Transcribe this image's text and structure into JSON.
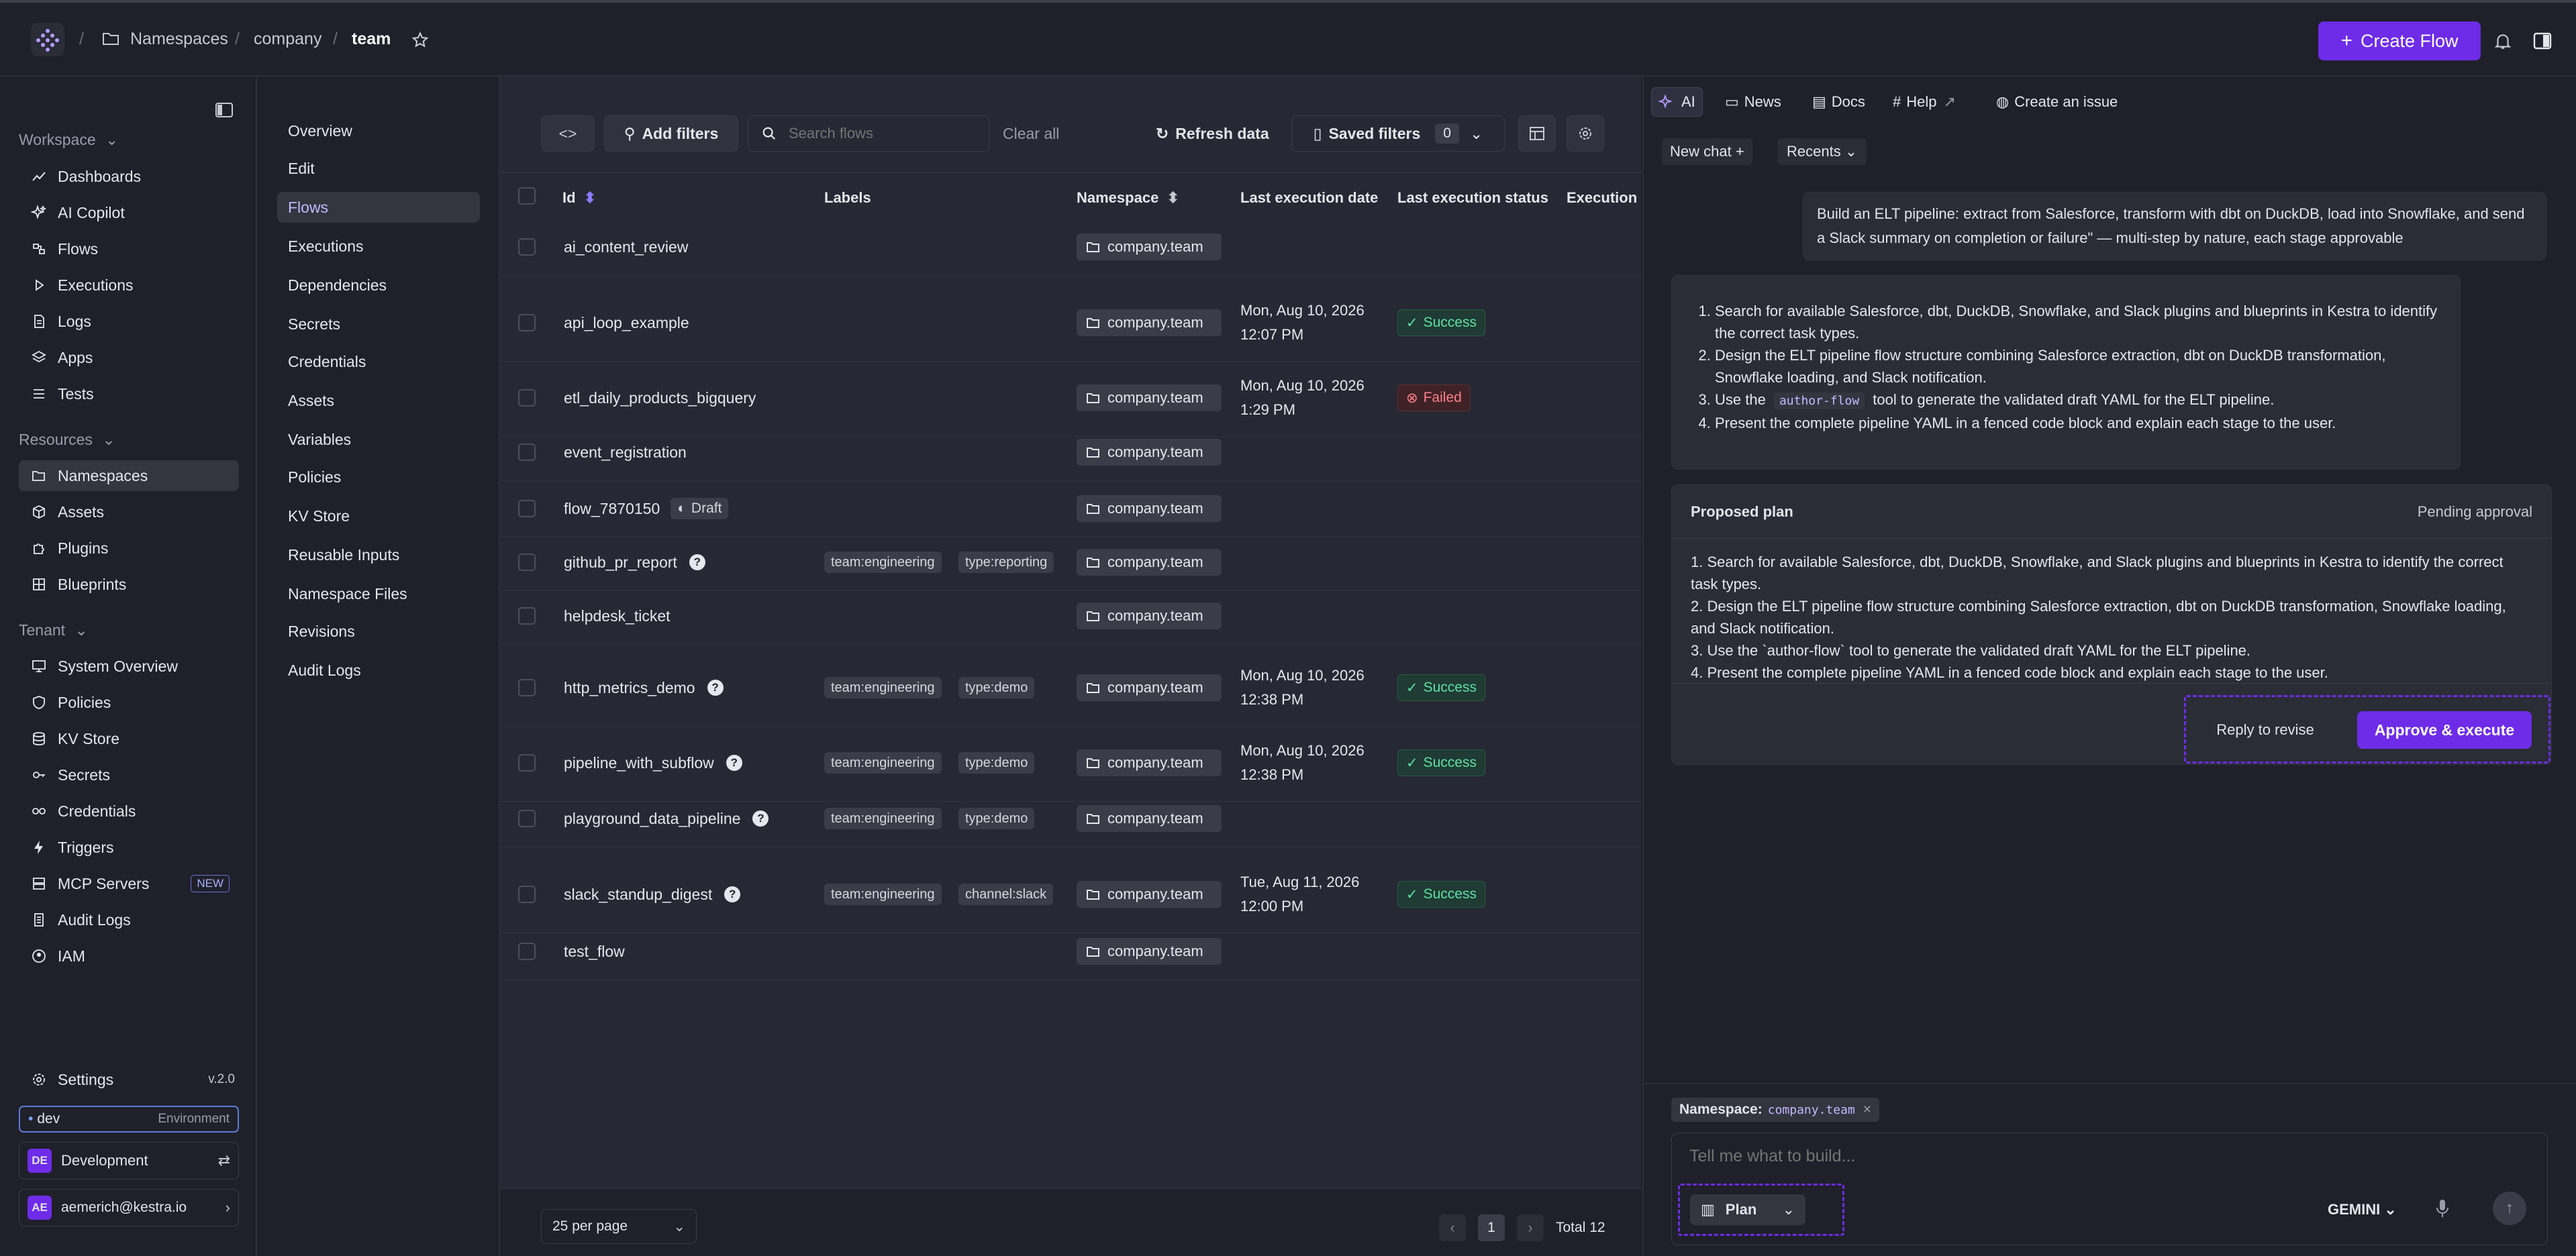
{
  "topbar": {
    "breadcrumb": [
      "Namespaces",
      "company",
      "team"
    ],
    "create_flow": "Create Flow"
  },
  "sidebar": {
    "sections": [
      {
        "title": "Workspace",
        "items": [
          "Dashboards",
          "AI Copilot",
          "Flows",
          "Executions",
          "Logs",
          "Apps",
          "Tests"
        ]
      },
      {
        "title": "Resources",
        "items": [
          "Namespaces",
          "Assets",
          "Plugins",
          "Blueprints"
        ]
      },
      {
        "title": "Tenant",
        "items": [
          "System Overview",
          "Policies",
          "KV Store",
          "Secrets",
          "Credentials",
          "Triggers",
          "MCP Servers",
          "Audit Logs",
          "IAM"
        ]
      }
    ],
    "new_badge": "NEW",
    "settings": "Settings",
    "version": "v.2.0",
    "env": {
      "name": "dev",
      "label": "Environment"
    },
    "tenant": {
      "initials": "DE",
      "name": "Development"
    },
    "user": {
      "initials": "AE",
      "email": "aemerich@kestra.io"
    }
  },
  "subnav": [
    "Overview",
    "Edit",
    "Flows",
    "Executions",
    "Dependencies",
    "Secrets",
    "Credentials",
    "Assets",
    "Variables",
    "Policies",
    "KV Store",
    "Reusable Inputs",
    "Namespace Files",
    "Revisions",
    "Audit Logs"
  ],
  "toolbar": {
    "add_filters": "Add filters",
    "search_placeholder": "Search flows",
    "clear_all": "Clear all",
    "refresh": "Refresh data",
    "saved_filters": "Saved filters",
    "saved_count": "0"
  },
  "table": {
    "headers": [
      "Id",
      "Labels",
      "Namespace",
      "Last execution date",
      "Last execution status",
      "Execution s"
    ],
    "rows": [
      {
        "id": "ai_content_review",
        "labels": [],
        "ns": "company.team",
        "date": [
          "",
          ""
        ],
        "status": ""
      },
      {
        "id": "api_loop_example",
        "labels": [],
        "ns": "company.team",
        "date": [
          "Mon, Aug 10, 2026",
          "12:07 PM"
        ],
        "status": "Success"
      },
      {
        "id": "etl_daily_products_bigquery",
        "labels": [],
        "ns": "company.team",
        "date": [
          "Mon, Aug 10, 2026",
          "1:29 PM"
        ],
        "status": "Failed"
      },
      {
        "id": "event_registration",
        "labels": [],
        "ns": "company.team",
        "date": [
          "",
          ""
        ],
        "status": ""
      },
      {
        "id": "flow_7870150",
        "draft": "Draft",
        "labels": [],
        "ns": "company.team",
        "date": [
          "",
          ""
        ],
        "status": ""
      },
      {
        "id": "github_pr_report",
        "q": true,
        "labels": [
          "team:engineering",
          "type:reporting"
        ],
        "ns": "company.team",
        "date": [
          "",
          ""
        ],
        "status": ""
      },
      {
        "id": "helpdesk_ticket",
        "labels": [],
        "ns": "company.team",
        "date": [
          "",
          ""
        ],
        "status": ""
      },
      {
        "id": "http_metrics_demo",
        "q": true,
        "labels": [
          "team:engineering",
          "type:demo"
        ],
        "ns": "company.team",
        "date": [
          "Mon, Aug 10, 2026",
          "12:38 PM"
        ],
        "status": "Success"
      },
      {
        "id": "pipeline_with_subflow",
        "q": true,
        "labels": [
          "team:engineering",
          "type:demo"
        ],
        "ns": "company.team",
        "date": [
          "Mon, Aug 10, 2026",
          "12:38 PM"
        ],
        "status": "Success"
      },
      {
        "id": "playground_data_pipeline",
        "q": true,
        "labels": [
          "team:engineering",
          "type:demo"
        ],
        "ns": "company.team",
        "date": [
          "",
          ""
        ],
        "status": ""
      },
      {
        "id": "slack_standup_digest",
        "q": true,
        "labels": [
          "team:engineering",
          "channel:slack"
        ],
        "ns": "company.team",
        "date": [
          "Tue, Aug 11, 2026",
          "12:00 PM"
        ],
        "status": "Success"
      },
      {
        "id": "test_flow",
        "labels": [],
        "ns": "company.team",
        "date": [
          "",
          ""
        ],
        "status": ""
      }
    ]
  },
  "pagination": {
    "per_page": "25 per page",
    "page": "1",
    "total": "Total 12"
  },
  "ai": {
    "tabs": [
      "AI",
      "News",
      "Docs",
      "Help",
      "Create an issue"
    ],
    "new_chat": "New chat +",
    "recents": "Recents",
    "user_message": "Build an ELT pipeline: extract from Salesforce, transform with dbt on DuckDB, load into Snowflake, and send a Slack summary on completion or failure\" — multi-step by nature, each stage approvable",
    "steps": [
      "Search for available Salesforce, dbt, DuckDB, Snowflake, and Slack plugins and blueprints in Kestra to identify the correct task types.",
      "Design the ELT pipeline flow structure combining Salesforce extraction, dbt on DuckDB transformation, Snowflake loading, and Slack notification.",
      "tool to generate the validated draft YAML for the ELT pipeline.",
      "Present the complete pipeline YAML in a fenced code block and explain each stage to the user."
    ],
    "step3_prefix": "Use the",
    "step3_code": "author-flow",
    "plan": {
      "title": "Proposed plan",
      "status": "Pending approval",
      "lines": [
        "1. Search for available Salesforce, dbt, DuckDB, Snowflake, and Slack plugins and blueprints in Kestra to identify the correct task types.",
        "2. Design the ELT pipeline flow structure combining Salesforce extraction, dbt on DuckDB transformation, Snowflake loading, and Slack notification.",
        "3. Use the `author-flow` tool to generate the validated draft YAML for the ELT pipeline.",
        "4. Present the complete pipeline YAML in a fenced code block and explain each stage to the user."
      ],
      "reply": "Reply to revise",
      "approve": "Approve & execute"
    },
    "namespace_chip": {
      "label": "Namespace:",
      "value": "company.team"
    },
    "input_placeholder": "Tell me what to build...",
    "mode": "Plan",
    "model": "GEMINI"
  },
  "colors": {
    "accent": "#6e2ce8",
    "success": "#5ee0a7",
    "failed": "#ff7e8b"
  }
}
